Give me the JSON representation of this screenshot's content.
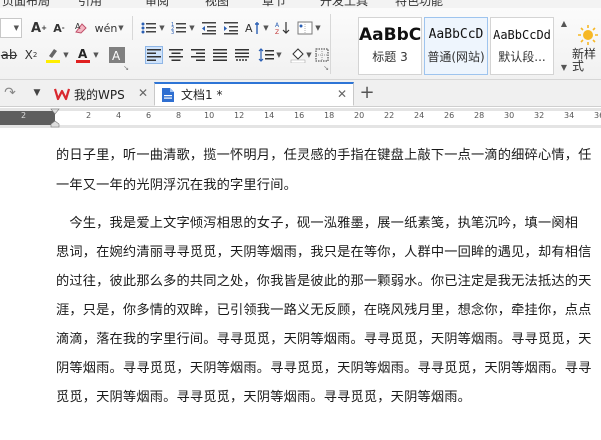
{
  "menu": {
    "items": [
      "页面布局",
      "引用",
      "审阅",
      "视图",
      "章节",
      "开发工具",
      "特色功能"
    ]
  },
  "ribbon": {
    "font_size_dropdown_value": "",
    "styles": [
      {
        "preview": "AaBbC",
        "name": "标题 3"
      },
      {
        "preview": "AaBbCcD",
        "name": "普通(网站)"
      },
      {
        "preview": "AaBbCcDd",
        "name": "默认段..."
      }
    ],
    "new_style_label": "新样式",
    "accent_colors": {
      "highlight": "#ffee00",
      "font_color": "#e02020",
      "shading": "#808080"
    }
  },
  "tabs": [
    {
      "label": "我的WPS",
      "icon": "wps-logo-icon",
      "active": false
    },
    {
      "label": "文档1 *",
      "icon": "document-icon",
      "active": true
    }
  ],
  "ruler": {
    "left_labels": [
      "2"
    ],
    "labels": [
      "2",
      "4",
      "6",
      "8",
      "10",
      "12",
      "14",
      "16",
      "18",
      "20",
      "22",
      "24",
      "26",
      "28",
      "30",
      "32",
      "34",
      "36",
      "38"
    ]
  },
  "document": {
    "lines": [
      "的日子里，听一曲清歌，揽一怀明月，任灵感的手指在键盘上敲下一点一滴的细碎心情，任",
      "一年又一年的光阴浮沉在我的字里行间。",
      "　今生，我是爱上文字倾泻相思的女子，砚一泓雅墨，展一纸素笺，执笔沉吟，填一阕相",
      "思词，在婉约清丽寻寻觅觅，天阴等烟雨，我只是在等你，人群中一回眸的遇见，却有相信",
      "的过往，彼此那么多的共同之处，你我皆是彼此的那一颗弱水。你已注定是我无法抵达的天",
      "涯，只是，你多情的双眸，已引领我一路义无反顾，在晓风残月里，想念你，牵挂你，点点",
      "滴滴，落在我的字里行间。寻寻觅觅，天阴等烟雨。寻寻觅觅，天阴等烟雨。寻寻觅觅，天",
      "阴等烟雨。寻寻觅觅，天阴等烟雨。寻寻觅觅，天阴等烟雨。寻寻觅觅，天阴等烟雨。寻寻",
      "觅觅，天阴等烟雨。寻寻觅觅，天阴等烟雨。寻寻觅觅，天阴等烟雨。"
    ]
  }
}
